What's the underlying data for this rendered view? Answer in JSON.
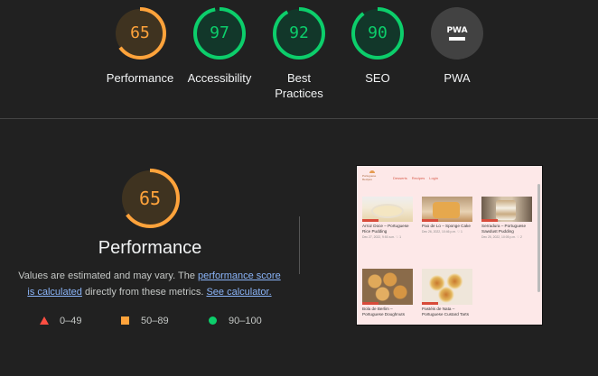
{
  "categories": [
    {
      "score": "65",
      "label": "Performance",
      "value": 65,
      "color": "#ffa33b",
      "track": "#3f3320",
      "text": "#ffa33b"
    },
    {
      "score": "97",
      "label": "Accessibility",
      "value": 97,
      "color": "#0cce6b",
      "track": "#12372a",
      "text": "#0cce6b"
    },
    {
      "score": "92",
      "label": "Best\nPractices",
      "value": 92,
      "color": "#0cce6b",
      "track": "#12372a",
      "text": "#0cce6b"
    },
    {
      "score": "90",
      "label": "SEO",
      "value": 90,
      "color": "#0cce6b",
      "track": "#12372a",
      "text": "#0cce6b"
    },
    {
      "score": "",
      "label": "PWA",
      "value": null,
      "color": "#424242",
      "track": "#424242",
      "text": "#ffffff"
    }
  ],
  "pwa_badge_text": "PWA",
  "detail": {
    "score": "65",
    "value": 65,
    "color": "#ffa33b",
    "title": "Performance",
    "note_prefix": "Values are estimated and may vary. The ",
    "note_link1": "performance score is calculated",
    "note_mid": " directly from these metrics. ",
    "note_link2": "See calculator."
  },
  "legend": [
    {
      "range": "0–49",
      "shape": "triangle",
      "color": "#ff4e42"
    },
    {
      "range": "50–89",
      "shape": "square",
      "color": "#ffa33b"
    },
    {
      "range": "90–100",
      "shape": "circle",
      "color": "#0cce6b"
    }
  ],
  "screenshot": {
    "logo": "Portuguese Recipes",
    "nav": [
      "Desserts",
      "Recipes",
      "Login"
    ],
    "cards": [
      {
        "title": "Arroz Doce – Portuguese Rice Pudding",
        "meta": "Dec 27, 2022, 9:50 a.m. ♡ 1"
      },
      {
        "title": "Pao de Lo – Sponge Cake",
        "meta": "Dec 26, 2022, 10:46 p.m. ♡ 1"
      },
      {
        "title": "Serradura – Portuguese Sawdust Pudding",
        "meta": "Dec 25, 2022, 10:05 p.m. ♡ 2"
      },
      {
        "title": "Bola de Berlim – Portuguese Doughnuts",
        "meta": ""
      },
      {
        "title": "Pastéis de Nata – Portuguese Custard Tarts",
        "meta": ""
      }
    ]
  }
}
